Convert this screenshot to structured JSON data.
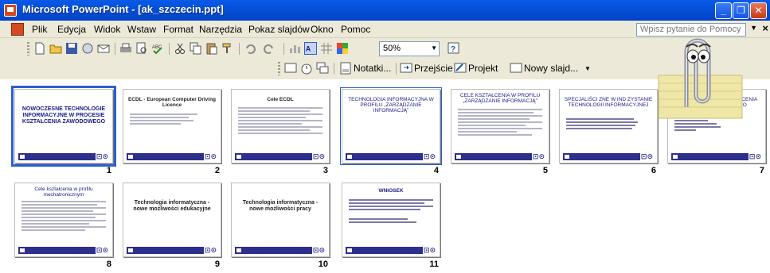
{
  "window": {
    "title": "Microsoft PowerPoint - [ak_szczecin.ppt]",
    "buttons": {
      "minimize": "_",
      "maximize": "❐",
      "close": "✕"
    }
  },
  "menubar": {
    "items": [
      "Plik",
      "Edycja",
      "Widok",
      "Wstaw",
      "Format",
      "Narzędzia",
      "Pokaz slajdów",
      "Okno",
      "Pomoc"
    ],
    "help_placeholder": "Wpisz pytanie do Pomocy",
    "close_doc": "×"
  },
  "toolbar": {
    "zoom": "50%",
    "notes_label": "Notatki...",
    "transition_label": "Przejście",
    "design_label": "Projekt",
    "new_slide_label": "Nowy slajd..."
  },
  "slides": [
    {
      "number": "1",
      "title": "NOWOCZESNE TECHNOLOGIE INFORMACYJNE W PROCESIE KSZTAŁCENIA ZAWODOWEGO",
      "selected": true
    },
    {
      "number": "2",
      "title": "ECDL - European Computer Driving Licence"
    },
    {
      "number": "3",
      "title": "Cele ECDL"
    },
    {
      "number": "4",
      "title": "TECHNOLOGIA INFORMACYJNA W PROFILU „ZARZĄDZANIE INFORMACJĄ”",
      "focused": true
    },
    {
      "number": "5",
      "title": "CELE KSZTAŁCENIA W PROFILU „ZARZĄDZANIE INFORMACJĄ”"
    },
    {
      "number": "6",
      "title": "SPECJALIŚCI ZNE W IND ZYSTANIE TECHNOLOGII INFORMACYJNEJ"
    },
    {
      "number": "7",
      "title": "KIERUNKI KSZTAŁCENIA ZAWODOWEGO"
    },
    {
      "number": "8",
      "title": "Cele kształcenia w profilu mechatronicznym"
    },
    {
      "number": "9",
      "title": "Technologia informatyczna - nowe możliwości edukacyjne"
    },
    {
      "number": "10",
      "title": "Technologia informatyczna - nowe możliwości pracy"
    },
    {
      "number": "11",
      "title": "WNIOSEK"
    }
  ],
  "colors": {
    "titlebar": "#0450d8",
    "selection": "#2a5fcf",
    "slide_footer": "#2d2f8c"
  }
}
